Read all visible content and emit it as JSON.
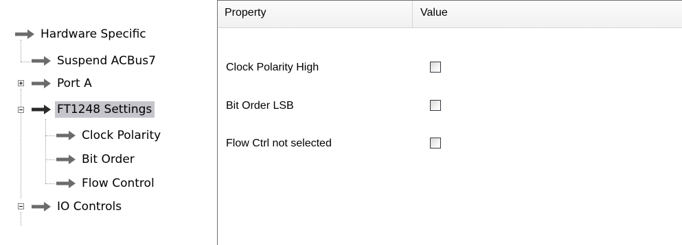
{
  "tree": {
    "nodes": [
      {
        "label": "Hardware Specific",
        "expander": null,
        "selected": false
      },
      {
        "label": "Suspend ACBus7",
        "expander": null,
        "selected": false
      },
      {
        "label": "Port A",
        "expander": "+",
        "selected": false
      },
      {
        "label": "FT1248 Settings",
        "expander": "-",
        "selected": true
      },
      {
        "label": "Clock Polarity",
        "expander": null,
        "selected": false
      },
      {
        "label": "Bit Order",
        "expander": null,
        "selected": false
      },
      {
        "label": "Flow Control",
        "expander": null,
        "selected": false
      },
      {
        "label": "IO Controls",
        "expander": "-",
        "selected": false
      }
    ],
    "icon": "right-arrow-icon",
    "selected_highlight_color": "#c5c5cb"
  },
  "grid": {
    "columns": {
      "property": "Property",
      "value": "Value"
    },
    "rows": [
      {
        "property": "Clock Polarity High",
        "checked": false
      },
      {
        "property": "Bit Order LSB",
        "checked": false
      },
      {
        "property": "Flow Ctrl not selected",
        "checked": false
      }
    ]
  }
}
